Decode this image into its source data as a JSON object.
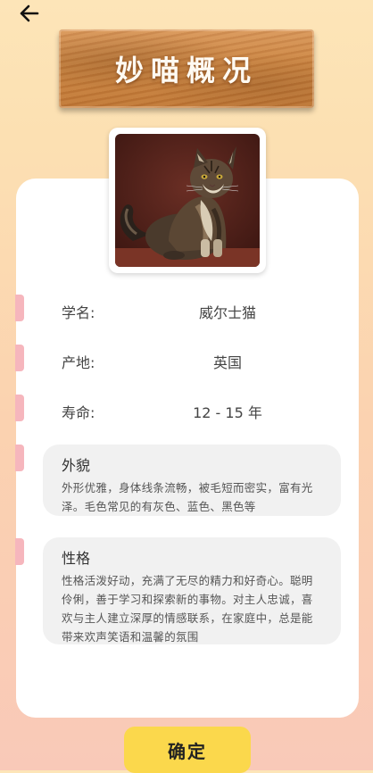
{
  "header": {
    "back_icon": "arrow-left-icon",
    "title": "妙喵概况"
  },
  "cat": {
    "photo_alt": "cat-photo"
  },
  "info": [
    {
      "label": "学名:",
      "value": "威尔士猫"
    },
    {
      "label": "产地:",
      "value": "英国"
    },
    {
      "label": "寿命:",
      "value": "12 - 15 年"
    }
  ],
  "appearance": {
    "title": "外貌",
    "body": "外形优雅，身体线条流畅，被毛短而密实，富有光泽。毛色常见的有灰色、蓝色、黑色等"
  },
  "personality": {
    "title": "性格",
    "body": "性格活泼好动，充满了无尽的精力和好奇心。聪明伶俐，善于学习和探索新的事物。对主人忠诚，喜欢与主人建立深厚的情感联系，在家庭中，总是能带来欢声笑语和温馨的氛围"
  },
  "footer": {
    "confirm_label": "确定"
  },
  "colors": {
    "accent_yellow": "#fbd84c",
    "marker_pink": "#f6b6bd"
  }
}
